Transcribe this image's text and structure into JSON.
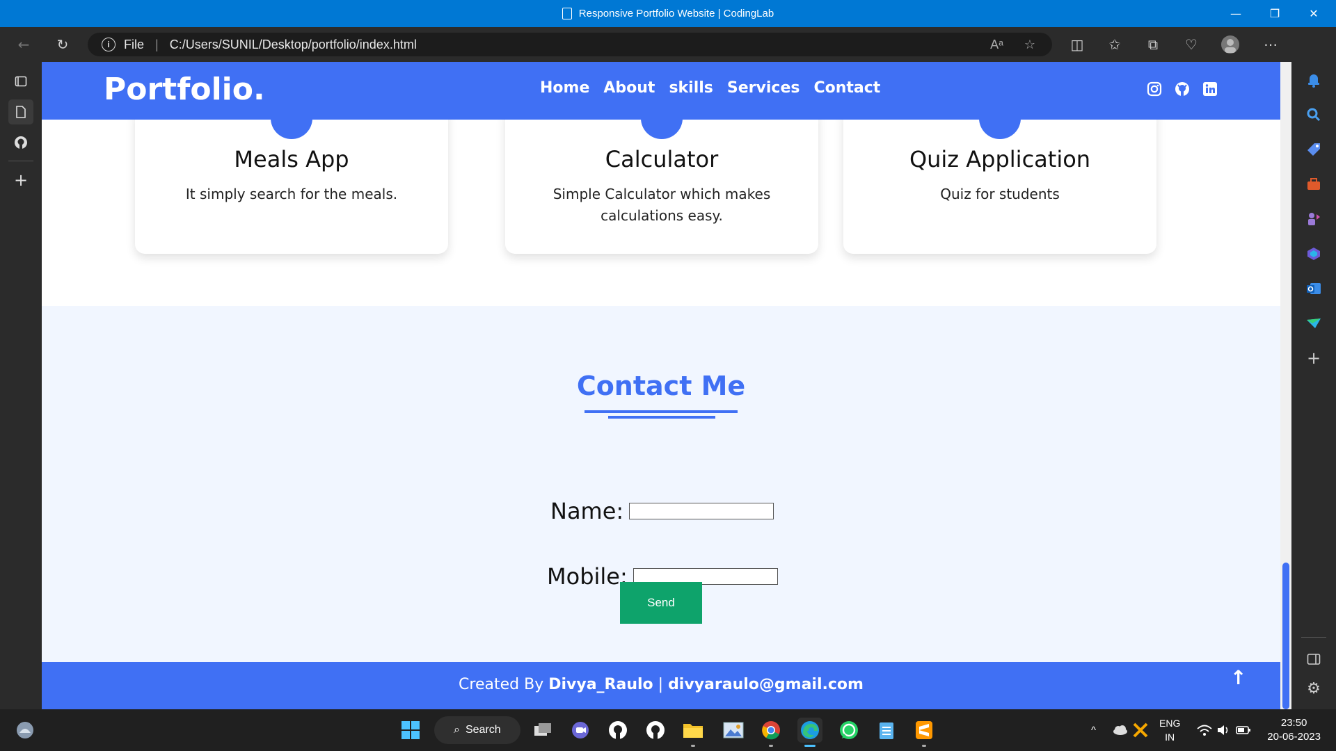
{
  "window": {
    "title": "Responsive Portfolio Website | CodingLab",
    "minimize": "—",
    "restore": "❐",
    "close": "✕"
  },
  "addressbar": {
    "scheme": "File",
    "url": "C:/Users/SUNIL/Desktop/portfolio/index.html",
    "read_aloud": "Aᵃ",
    "favorite": "☆",
    "split": "◫",
    "favorites": "✩",
    "collections": "⧉",
    "health": "♡",
    "more": "⋯",
    "back": "←",
    "refresh": "↻"
  },
  "page": {
    "brand": "Portfolio.",
    "menu": [
      "Home",
      "About",
      "skills",
      "Services",
      "Contact"
    ],
    "cards": [
      {
        "title": "Meals App",
        "desc": "It simply search for the meals."
      },
      {
        "title": "Calculator",
        "desc": "Simple Calculator which makes calculations easy."
      },
      {
        "title": "Quiz Application",
        "desc": "Quiz for students"
      }
    ],
    "contact": {
      "heading": "Contact Me",
      "name_label": "Name:",
      "mobile_label": "Mobile:",
      "send": "Send"
    },
    "footer": {
      "prefix": "Created By ",
      "author": "Divya_Raulo",
      "divider": " | ",
      "email": "divyaraulo@gmail.com",
      "up_arrow": "↑"
    }
  },
  "colors": {
    "accent": "#4070f4",
    "send": "#0ea36b",
    "contact_bg": "#f1f6ff",
    "titlebar": "#0078d4"
  },
  "taskbar": {
    "search": "Search",
    "lang_top": "ENG",
    "lang_bottom": "IN",
    "time": "23:50",
    "date": "20-06-2023"
  }
}
